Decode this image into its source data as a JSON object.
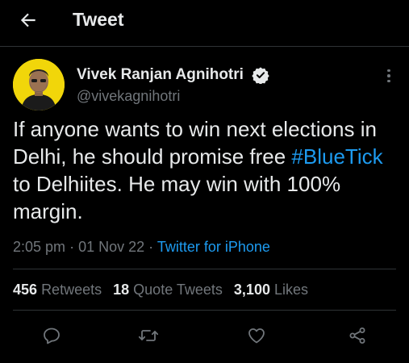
{
  "header": {
    "title": "Tweet",
    "back_icon": "arrow-left-icon"
  },
  "author": {
    "name": "Vivek Ranjan Agnihotri",
    "handle": "@vivekagnihotri",
    "verified_icon": "verified-badge-icon"
  },
  "tweet": {
    "text_before": "If anyone wants to win next elections in Delhi, he should promise free ",
    "hashtag": "#BlueTick",
    "text_after": " to Delhiites. He may win with 100% margin."
  },
  "meta": {
    "time": "2:05 pm",
    "sep1": "·",
    "date": "01 Nov 22",
    "sep2": "·",
    "source": "Twitter for iPhone"
  },
  "stats": {
    "retweets_count": "456",
    "retweets_label": "Retweets",
    "quotes_count": "18",
    "quotes_label": "Quote Tweets",
    "likes_count": "3,100",
    "likes_label": "Likes"
  },
  "actions": [
    "reply-icon",
    "retweet-icon",
    "like-icon",
    "share-icon"
  ],
  "colors": {
    "accent": "#1d9bf0",
    "secondary": "#71767b",
    "text": "#e7e9ea",
    "background": "#000000",
    "avatar_bg": "#f1d60a"
  }
}
